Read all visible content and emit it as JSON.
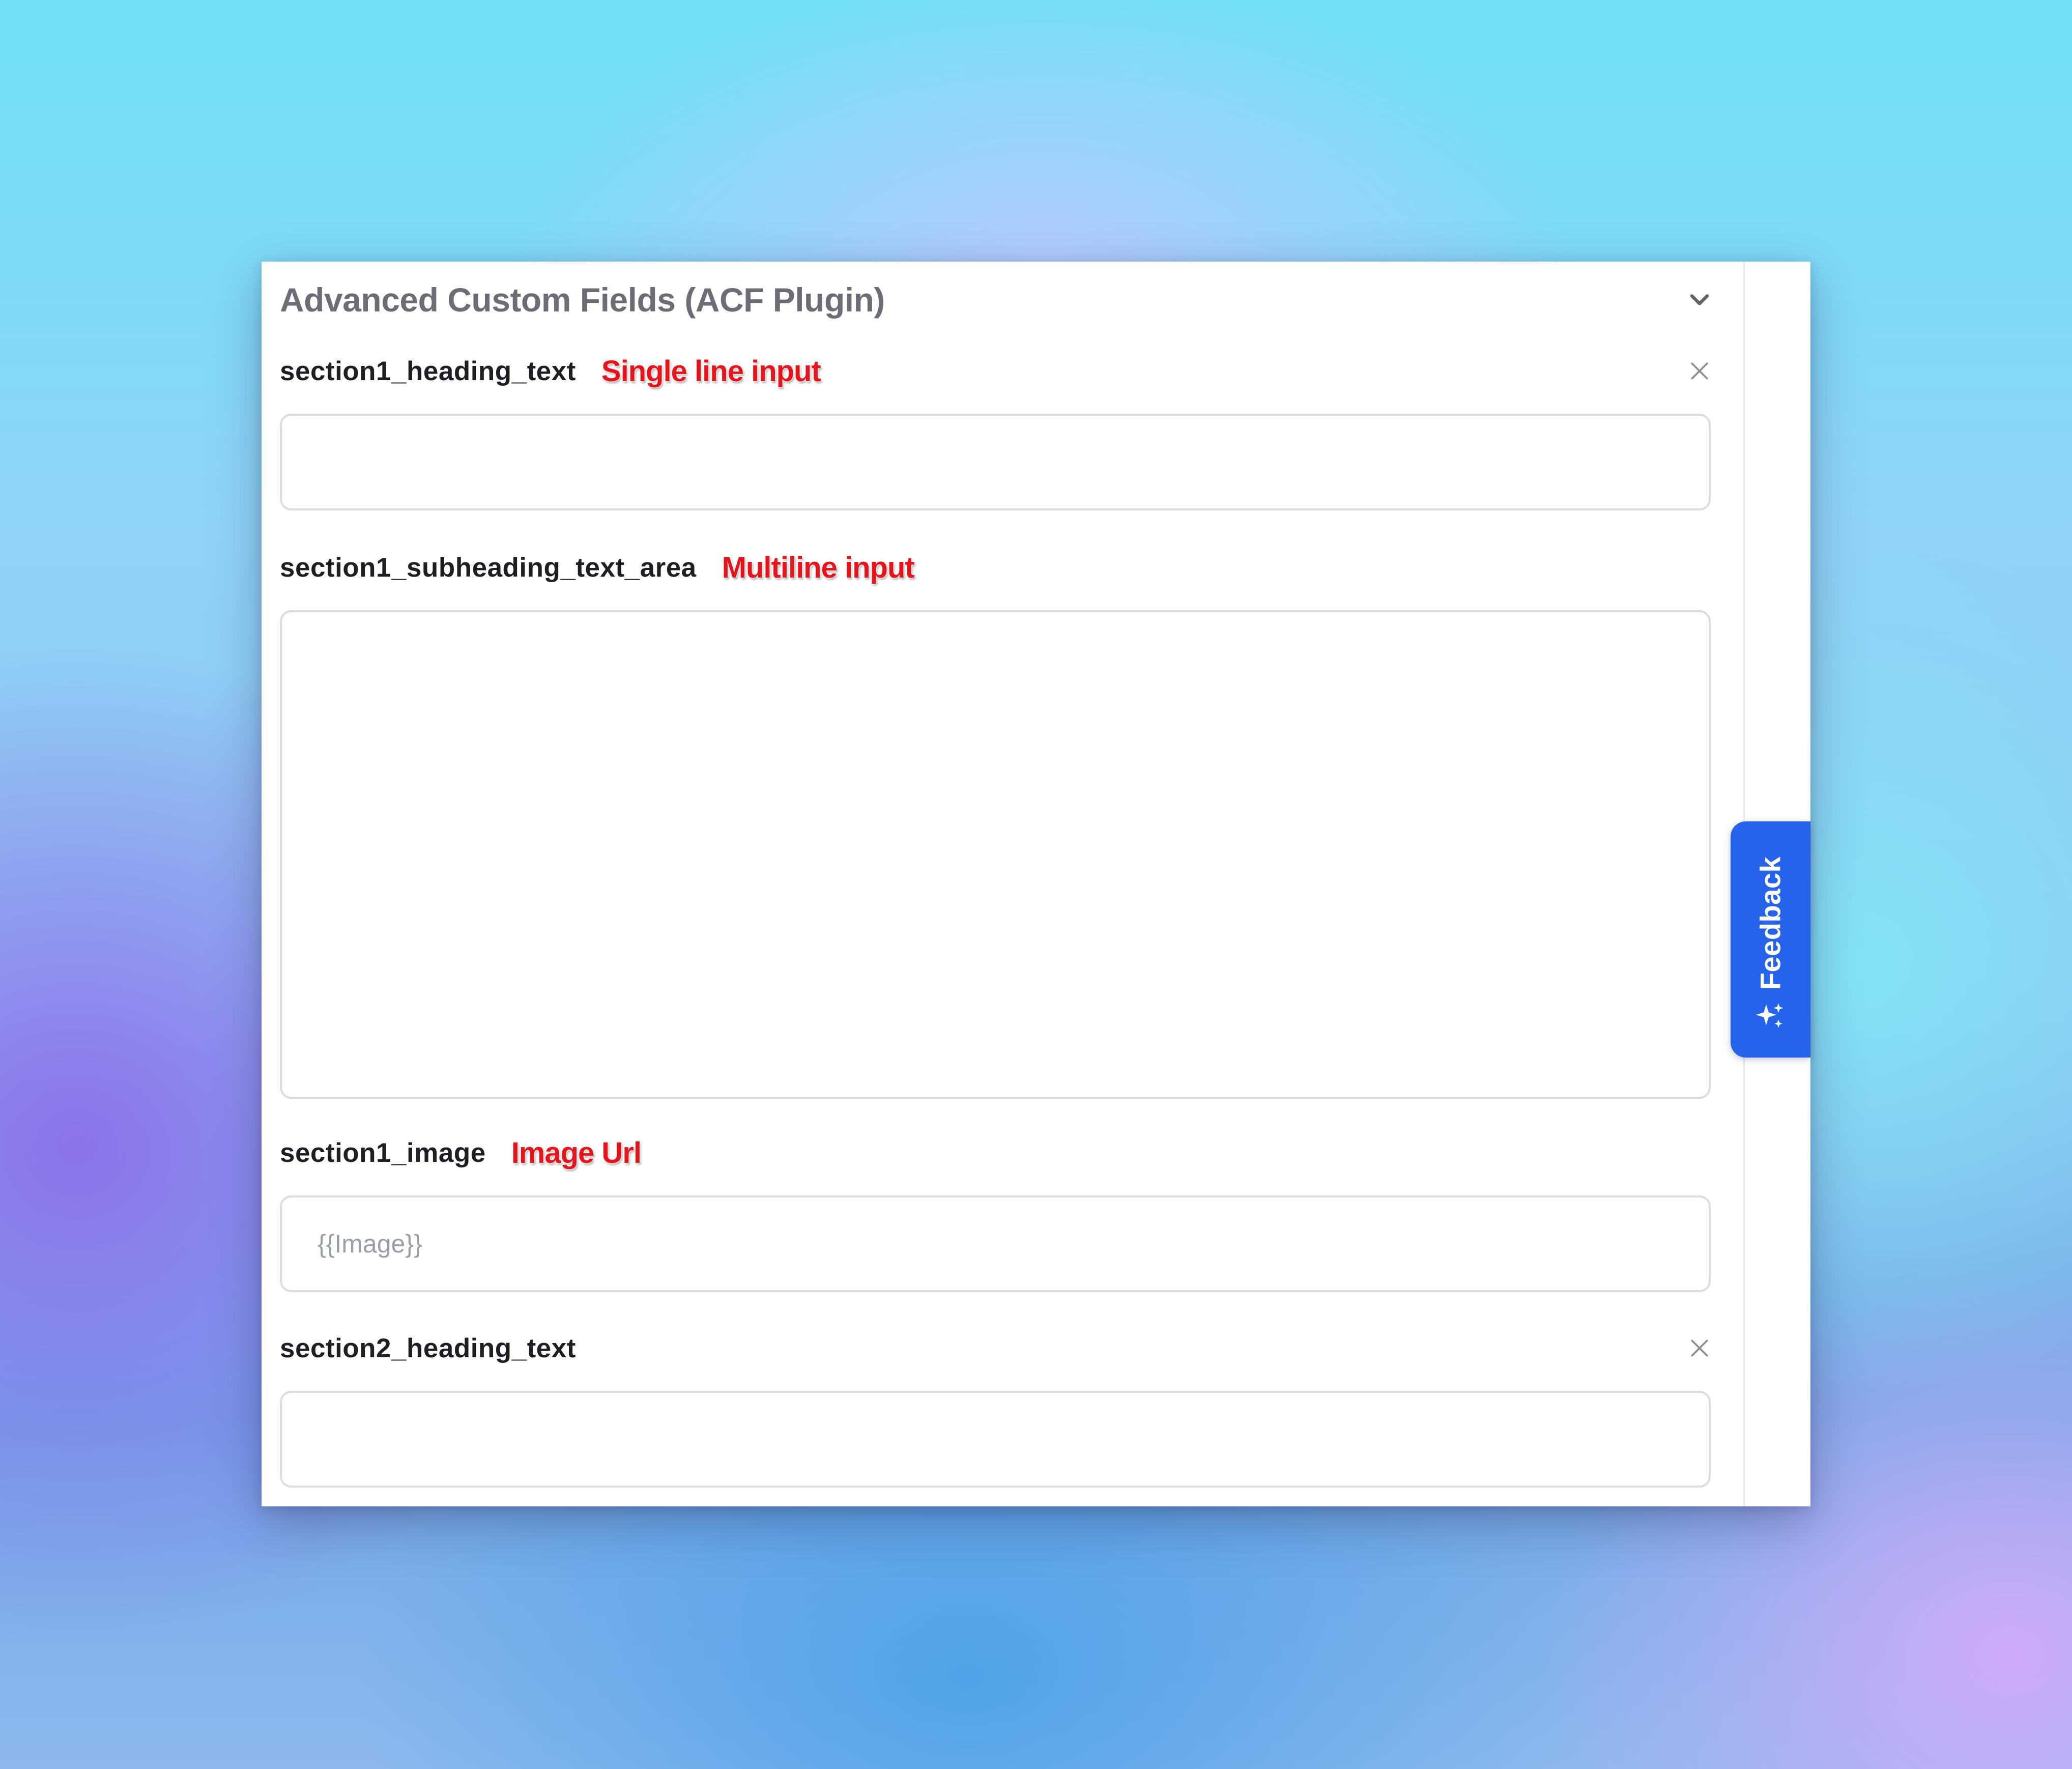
{
  "panel": {
    "title": "Advanced Custom Fields (ACF Plugin)",
    "collapse_icon": "chevron-down-icon"
  },
  "fields": [
    {
      "label": "section1_heading_text",
      "annotation": "Single line input",
      "value": "",
      "removable": true
    },
    {
      "label": "section1_subheading_text_area",
      "annotation": "Multiline input",
      "value": ""
    },
    {
      "label": "section1_image",
      "annotation": "Image Url",
      "placeholder": "{{Image}}"
    },
    {
      "label": "section2_heading_text",
      "value": "",
      "removable": true
    }
  ],
  "feedback": {
    "label": "Feedback",
    "icon": "sparkle-icon",
    "color": "#2563eb"
  },
  "colors": {
    "annotation": "#e8141b",
    "title": "#6b6e76",
    "label": "#1d1f24",
    "input_border": "#dadde2"
  }
}
